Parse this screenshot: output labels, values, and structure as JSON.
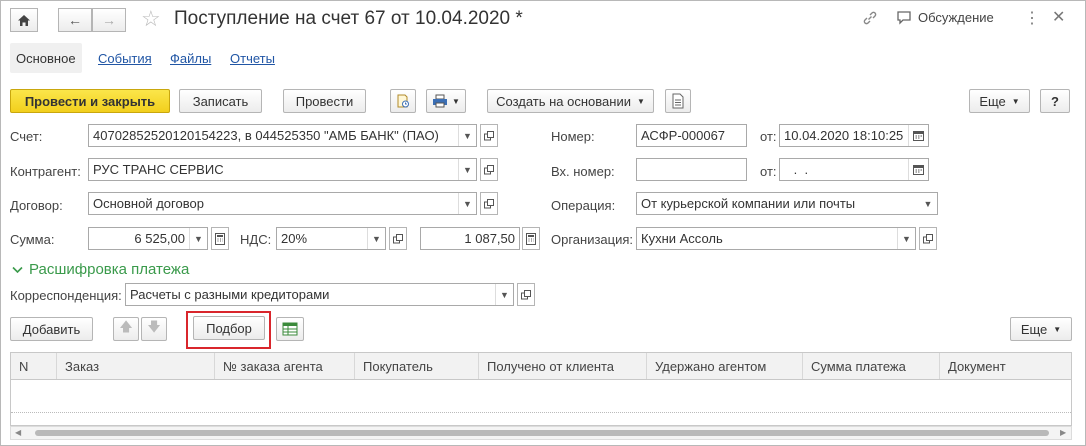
{
  "window": {
    "title": "Поступление на счет 67 от 10.04.2020 *",
    "discussion_label": "Обсуждение",
    "more_menu_icon": "⋮",
    "close_icon": "✕"
  },
  "tabs": [
    {
      "label": "Основное",
      "active": true
    },
    {
      "label": "События",
      "active": false
    },
    {
      "label": "Файлы",
      "active": false
    },
    {
      "label": "Отчеты",
      "active": false
    }
  ],
  "toolbar": {
    "post_and_close": "Провести и закрыть",
    "save": "Записать",
    "post": "Провести",
    "create_based_on": "Создать на основании",
    "more": "Еще",
    "help": "?"
  },
  "form": {
    "account_label": "Счет:",
    "account_value": "40702852520120154223, в 044525350 \"АМБ БАНК\" (ПАО)",
    "counterparty_label": "Контрагент:",
    "counterparty_value": "РУС ТРАНС СЕРВИС",
    "contract_label": "Договор:",
    "contract_value": "Основной договор",
    "amount_label": "Сумма:",
    "amount_value": "6 525,00",
    "vat_label": "НДС:",
    "vat_rate_value": "20%",
    "vat_amount_value": "1 087,50",
    "number_label": "Номер:",
    "number_value": "АСФР-000067",
    "from_label": "от:",
    "date_value": "10.04.2020 18:10:25",
    "incoming_number_label": "Вх. номер:",
    "incoming_number_value": "",
    "incoming_from_label": "от:",
    "incoming_date_value": " .  .",
    "operation_label": "Операция:",
    "operation_value": "От курьерской компании или почты",
    "organization_label": "Организация:",
    "organization_value": "Кухни Ассоль"
  },
  "payment_section": {
    "title": "Расшифровка платежа",
    "correspondence_label": "Корреспонденция:",
    "correspondence_value": "Расчеты с разными кредиторами",
    "add_button": "Добавить",
    "selection_button": "Подбор",
    "more": "Еще"
  },
  "table": {
    "columns": [
      "N",
      "Заказ",
      "№ заказа агента",
      "Покупатель",
      "Получено от клиента",
      "Удержано агентом",
      "Сумма платежа",
      "Документ"
    ],
    "rows": []
  },
  "colors": {
    "primary_button": "#f2cf1d",
    "link": "#2156a5",
    "section_title": "#3a9a4b",
    "highlight_box": "#d9262c"
  }
}
